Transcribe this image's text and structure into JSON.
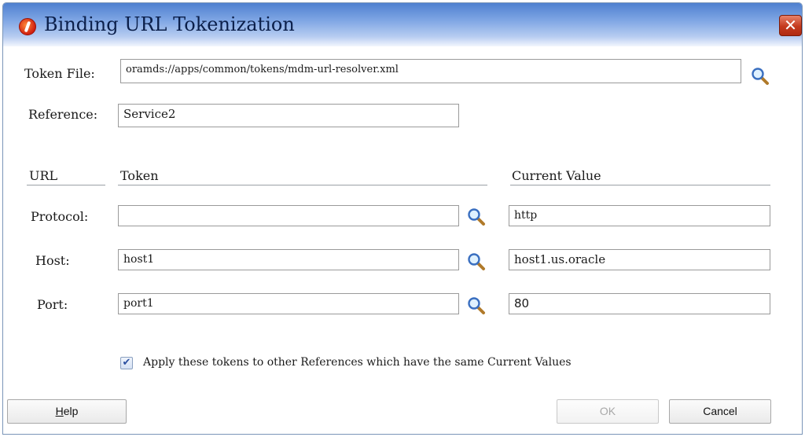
{
  "window": {
    "title": "Binding URL Tokenization",
    "close_glyph": "✕"
  },
  "token_file": {
    "label": "Token File:",
    "value": "oramds://apps/common/tokens/mdm-url-resolver.xml"
  },
  "reference": {
    "label": "Reference:",
    "value": "Service2"
  },
  "columns": {
    "url": "URL",
    "token": "Token",
    "current_value": "Current Value"
  },
  "rows": [
    {
      "label": "Protocol:",
      "token": "",
      "current": "http"
    },
    {
      "label": "Host:",
      "token": "host1",
      "current": "host1.us.oracle"
    },
    {
      "label": "Port:",
      "token": "port1",
      "current": "80"
    }
  ],
  "apply_checkbox": {
    "checked": true,
    "label": "Apply these tokens to other References which have the same Current Values"
  },
  "buttons": {
    "help_mnemonic": "H",
    "help_rest": "elp",
    "ok": "OK",
    "cancel": "Cancel"
  },
  "icons": {
    "browse": "magnifier-icon",
    "app": "app-logo-icon",
    "close": "close-icon"
  },
  "colors": {
    "titlebar": "#6f98dc",
    "close_button": "#c43a1e"
  }
}
